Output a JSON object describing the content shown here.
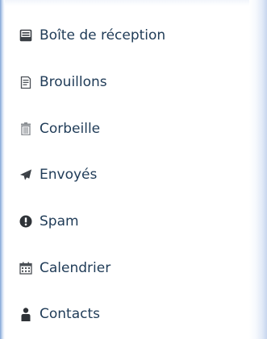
{
  "menu": {
    "items": [
      {
        "label": "Boîte de réception",
        "icon": "inbox-icon"
      },
      {
        "label": "Brouillons",
        "icon": "drafts-icon"
      },
      {
        "label": "Corbeille",
        "icon": "trash-icon"
      },
      {
        "label": "Envoyés",
        "icon": "sent-icon"
      },
      {
        "label": "Spam",
        "icon": "spam-icon"
      },
      {
        "label": "Calendrier",
        "icon": "calendar-icon"
      },
      {
        "label": "Contacts",
        "icon": "contacts-icon"
      }
    ]
  },
  "colors": {
    "text": "#1f3b57",
    "icon": "#3a3f45",
    "border": "#7fa3d6"
  }
}
